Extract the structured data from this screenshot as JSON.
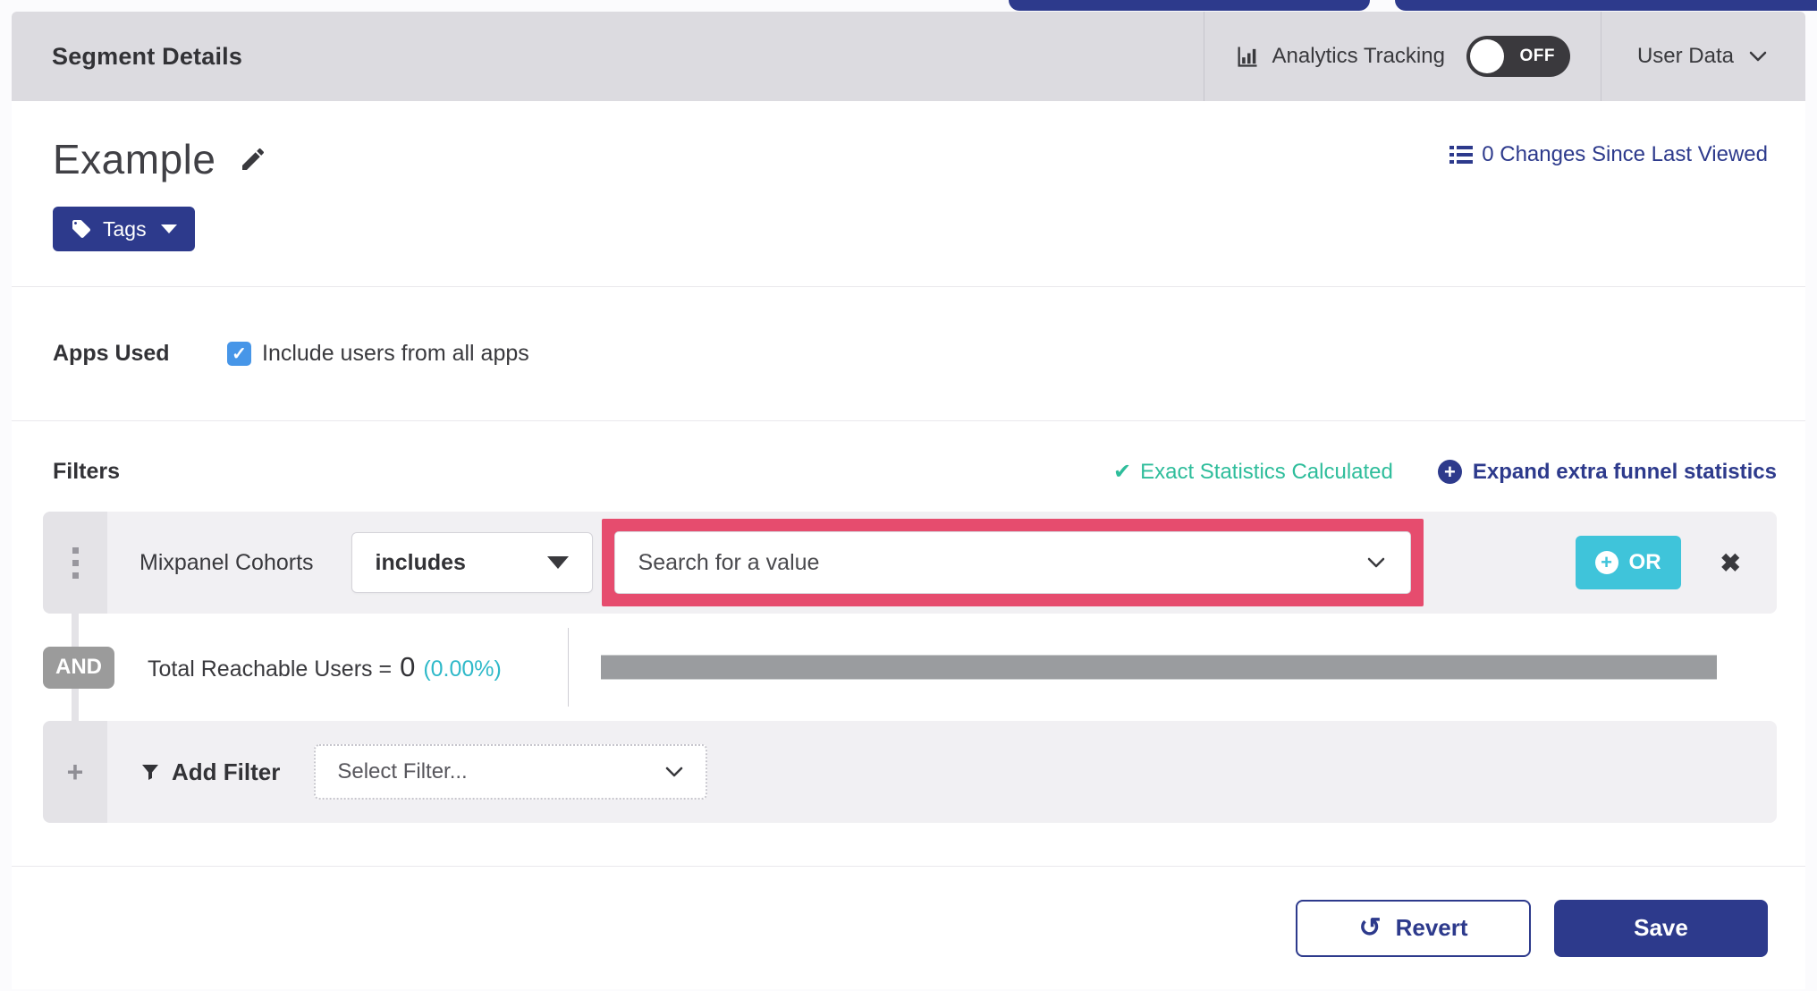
{
  "header": {
    "title": "Segment Details",
    "analytics_label": "Analytics Tracking",
    "toggle_state": "OFF",
    "user_data_label": "User Data"
  },
  "segment": {
    "name": "Example",
    "tags_button": "Tags",
    "changes_link": "0 Changes Since Last Viewed"
  },
  "apps_used": {
    "label": "Apps Used",
    "include_all_label": "Include users from all apps",
    "checked": true,
    "checkmark": "✓"
  },
  "filters": {
    "heading": "Filters",
    "exact_statistics": "Exact Statistics Calculated",
    "expand_funnel": "Expand extra funnel statistics",
    "row": {
      "attribute": "Mixpanel Cohorts",
      "operator": "includes",
      "value_placeholder": "Search for a value",
      "or_button": "OR",
      "close": "✖"
    },
    "and_badge": "AND",
    "reachable": {
      "label": "Total Reachable Users =",
      "count": "0",
      "percent": "(0.00%)"
    },
    "add_filter": {
      "plus": "+",
      "label": "Add Filter",
      "placeholder": "Select Filter..."
    }
  },
  "footer": {
    "revert_button": "Revert",
    "revert_icon": "↺",
    "save_button": "Save"
  },
  "icons": {
    "exact_check": "✔",
    "plus": "+"
  },
  "colors": {
    "navy": "#2d3a8c",
    "teal_button": "#3fc4da",
    "green_status": "#2ebd9b",
    "highlight_pink": "#e64c6e",
    "cyan_percent": "#2fb9c9",
    "checkbox_blue": "#4796e8",
    "toggle_off_bg": "#3a393d",
    "and_badge_gray": "#9b9b9b",
    "progress_bar_gray": "#9a9c9f",
    "header_bar_gray": "#dcdbe0"
  }
}
